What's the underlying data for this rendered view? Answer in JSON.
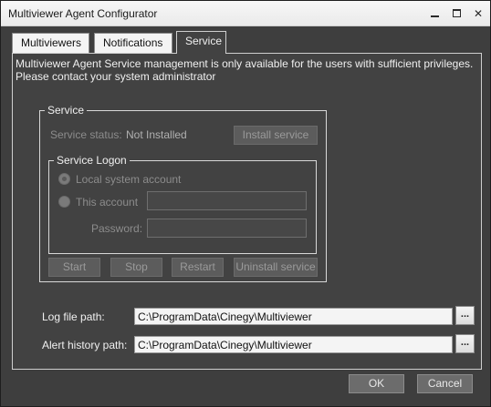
{
  "window": {
    "title": "Multiviewer Agent Configurator"
  },
  "tabs": [
    {
      "label": "Multiviewers"
    },
    {
      "label": "Notifications"
    },
    {
      "label": "Service"
    }
  ],
  "service_tab": {
    "message_line1": "Multiviewer Agent Service management is only available for the users with sufficient privileges.",
    "message_line2": "Please contact your system administrator",
    "service_group": {
      "title": "Service",
      "status_label": "Service status:",
      "status_value": "Not Installed",
      "install_button": "Install service"
    },
    "logon_group": {
      "title": "Service Logon",
      "local_account_label": "Local system account",
      "this_account_label": "This account",
      "account_value": "",
      "password_label": "Password:",
      "password_value": ""
    },
    "action_buttons": {
      "start": "Start",
      "stop": "Stop",
      "restart": "Restart",
      "uninstall": "Uninstall service"
    },
    "log_file": {
      "label": "Log file path:",
      "value": "C:\\ProgramData\\Cinegy\\Multiviewer",
      "browse": "..."
    },
    "alert_history": {
      "label": "Alert history path:",
      "value": "C:\\ProgramData\\Cinegy\\Multiviewer",
      "browse": "..."
    }
  },
  "footer": {
    "ok": "OK",
    "cancel": "Cancel"
  }
}
